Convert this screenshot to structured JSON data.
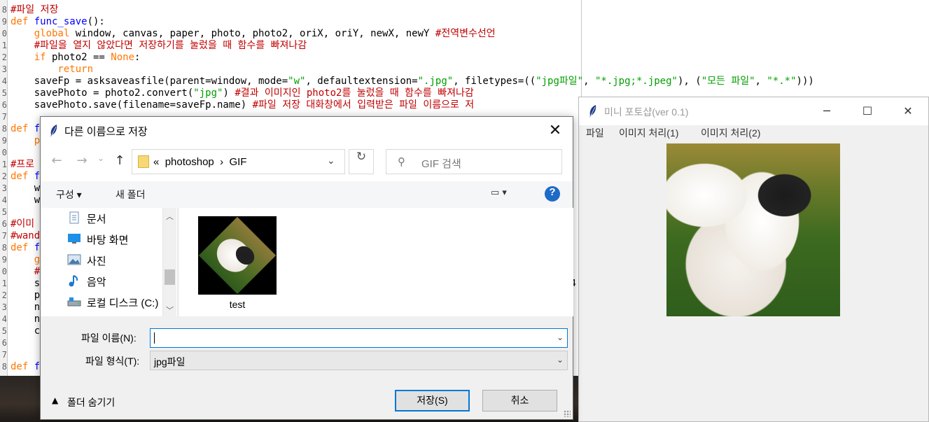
{
  "editor": {
    "lines": [
      {
        "segments": [
          {
            "t": "#파일 저장",
            "c": "cm"
          }
        ]
      },
      {
        "segments": [
          {
            "t": "def ",
            "c": "kw"
          },
          {
            "t": "func_save",
            "c": "df"
          },
          {
            "t": "():",
            "c": ""
          }
        ]
      },
      {
        "segments": [
          {
            "t": "    global",
            "c": "kw"
          },
          {
            "t": " window, canvas, paper, photo, photo2, oriX, oriY, newX, newY ",
            "c": ""
          },
          {
            "t": "#전역변수선언",
            "c": "cm"
          }
        ]
      },
      {
        "segments": [
          {
            "t": "    #파일을 열지 않았다면 저장하기를 눌렀을 때 함수를 빠져나감",
            "c": "cm"
          }
        ]
      },
      {
        "segments": [
          {
            "t": "    if",
            "c": "kw"
          },
          {
            "t": " photo2 == ",
            "c": ""
          },
          {
            "t": "None",
            "c": "kw"
          },
          {
            "t": ":",
            "c": ""
          }
        ]
      },
      {
        "segments": [
          {
            "t": "        return",
            "c": "kw"
          }
        ]
      },
      {
        "segments": [
          {
            "t": "    saveFp = asksaveasfile(parent=window, mode=",
            "c": ""
          },
          {
            "t": "\"w\"",
            "c": "st"
          },
          {
            "t": ", defaultextension=",
            "c": ""
          },
          {
            "t": "\".jpg\"",
            "c": "st"
          },
          {
            "t": ", filetypes=((",
            "c": ""
          },
          {
            "t": "\"jpg파일\"",
            "c": "st"
          },
          {
            "t": ", ",
            "c": ""
          },
          {
            "t": "\"*.jpg;*.jpeg\"",
            "c": "st"
          },
          {
            "t": "), (",
            "c": ""
          },
          {
            "t": "\"모든 파일\"",
            "c": "st"
          },
          {
            "t": ", ",
            "c": ""
          },
          {
            "t": "\"*.*\"",
            "c": "st"
          },
          {
            "t": ")))",
            "c": ""
          }
        ]
      },
      {
        "segments": [
          {
            "t": "    savePhoto = photo2.convert(",
            "c": ""
          },
          {
            "t": "\"jpg\"",
            "c": "st"
          },
          {
            "t": ") ",
            "c": ""
          },
          {
            "t": "#결과 이미지인 photo2를 눌렀을 때 함수를 빠져나감",
            "c": "cm"
          }
        ]
      },
      {
        "segments": [
          {
            "t": "    savePhoto.save(filename=saveFp.name) ",
            "c": ""
          },
          {
            "t": "#파일 저장 대화창에서 입력받은 파일 이름으로 저",
            "c": "cm"
          }
        ]
      },
      {
        "segments": [
          {
            "t": "",
            "c": ""
          }
        ]
      },
      {
        "segments": [
          {
            "t": "def ",
            "c": "kw"
          },
          {
            "t": "f",
            "c": "df"
          }
        ]
      },
      {
        "segments": [
          {
            "t": "    p",
            "c": "kw"
          }
        ]
      },
      {
        "segments": [
          {
            "t": "",
            "c": ""
          }
        ]
      },
      {
        "segments": [
          {
            "t": "#프로",
            "c": "cm"
          }
        ]
      },
      {
        "segments": [
          {
            "t": "def ",
            "c": "kw"
          },
          {
            "t": "f",
            "c": "df"
          }
        ]
      },
      {
        "segments": [
          {
            "t": "    w",
            "c": ""
          }
        ]
      },
      {
        "segments": [
          {
            "t": "    w",
            "c": ""
          }
        ]
      },
      {
        "segments": [
          {
            "t": "",
            "c": ""
          }
        ]
      },
      {
        "segments": [
          {
            "t": "#이미",
            "c": "cm"
          }
        ]
      },
      {
        "segments": [
          {
            "t": "#wand",
            "c": "cm"
          }
        ]
      },
      {
        "segments": [
          {
            "t": "def ",
            "c": "kw"
          },
          {
            "t": "f",
            "c": "df"
          }
        ]
      },
      {
        "segments": [
          {
            "t": "    g",
            "c": "kw"
          }
        ]
      },
      {
        "segments": [
          {
            "t": "    #",
            "c": "cm"
          }
        ]
      },
      {
        "segments": [
          {
            "t": "    s",
            "c": ""
          }
        ]
      },
      {
        "segments": [
          {
            "t": "    p",
            "c": ""
          }
        ]
      },
      {
        "segments": [
          {
            "t": "    n",
            "c": ""
          }
        ]
      },
      {
        "segments": [
          {
            "t": "    n",
            "c": ""
          }
        ]
      },
      {
        "segments": [
          {
            "t": "    c",
            "c": ""
          }
        ]
      },
      {
        "segments": [
          {
            "t": "",
            "c": ""
          }
        ]
      },
      {
        "segments": [
          {
            "t": "",
            "c": ""
          }
        ]
      },
      {
        "segments": [
          {
            "t": "def ",
            "c": "kw"
          },
          {
            "t": "f",
            "c": "df"
          }
        ]
      }
    ],
    "gutter_numbers": [
      "8",
      "9",
      "0",
      "1",
      "2",
      "3",
      "4",
      "5",
      "6",
      "7",
      "8",
      "9",
      "0",
      "1",
      "2",
      "3",
      "4",
      "5",
      "6",
      "7",
      "8",
      "9",
      "0",
      "1",
      "2",
      "3",
      "4",
      "5",
      "6",
      "7",
      "8"
    ],
    "right_fragment": "4"
  },
  "mini_window": {
    "title": "미니 포토샵(ver 0.1)",
    "minimize": "─",
    "maximize": "☐",
    "close": "✕",
    "menu": [
      "파일",
      "이미지 처리(1)",
      "이미지 처리(2)"
    ],
    "image_icon": "puppy-photo"
  },
  "dialog": {
    "title": "다른 이름으로 저장",
    "close": "✕",
    "nav": {
      "back": "←",
      "forward": "→",
      "recent": "⌄",
      "up": "↑"
    },
    "address": {
      "prefix": "«",
      "path": [
        "photoshop",
        "GIF"
      ],
      "separator": "›",
      "dropdown": "⌄"
    },
    "refresh": "↻",
    "search_placeholder": "GIF 검색",
    "toolbar": {
      "organize": "구성 ▾",
      "new_folder": "새 폴더",
      "view": "▭ ▾",
      "help": "?"
    },
    "sidebar": [
      {
        "label": "문서",
        "icon": "document-icon"
      },
      {
        "label": "바탕 화면",
        "icon": "desktop-icon"
      },
      {
        "label": "사진",
        "icon": "pictures-icon"
      },
      {
        "label": "음악",
        "icon": "music-icon"
      },
      {
        "label": "로컬 디스크 (C:)",
        "icon": "drive-icon"
      }
    ],
    "files": [
      {
        "name": "test"
      }
    ],
    "filename_label": "파일 이름(N):",
    "filename_value": "",
    "filetype_label": "파일 형식(T):",
    "filetype_value": "jpg파일",
    "hide_folders": "폴더 숨기기",
    "save_button": "저장(S)",
    "cancel_button": "취소",
    "accent": "#0078d7"
  }
}
